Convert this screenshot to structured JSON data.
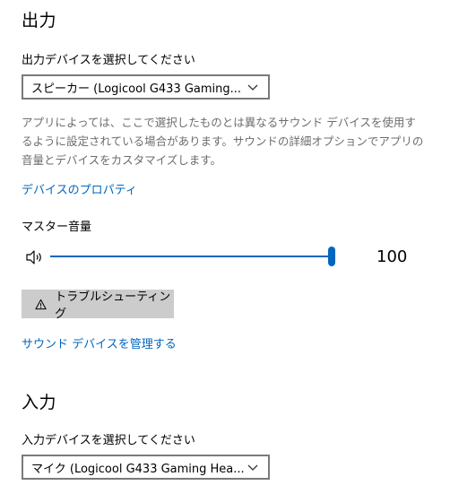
{
  "output": {
    "title": "出力",
    "select_label": "出力デバイスを選択してください",
    "selected_device": "スピーカー (Logicool G433 Gaming...",
    "description": "アプリによっては、ここで選択したものとは異なるサウンド デバイスを使用するように設定されている場合があります。サウンドの詳細オプションでアプリの音量とデバイスをカスタマイズします。",
    "properties_link": "デバイスのプロパティ",
    "master_volume_label": "マスター音量",
    "volume_value": "100",
    "volume_level_percent": 100,
    "troubleshoot_label": "トラブルシューティング",
    "manage_devices_link": "サウンド デバイスを管理する"
  },
  "input": {
    "title": "入力",
    "select_label": "入力デバイスを選択してください",
    "selected_device": "マイク (Logicool G433 Gaming Hea..."
  },
  "colors": {
    "accent": "#0067c0",
    "button_bg": "#cccccc",
    "description_text": "#6d6d6d"
  },
  "icons": {
    "speaker": "speaker-icon",
    "warning": "warning-icon",
    "chevron": "chevron-down-icon"
  }
}
